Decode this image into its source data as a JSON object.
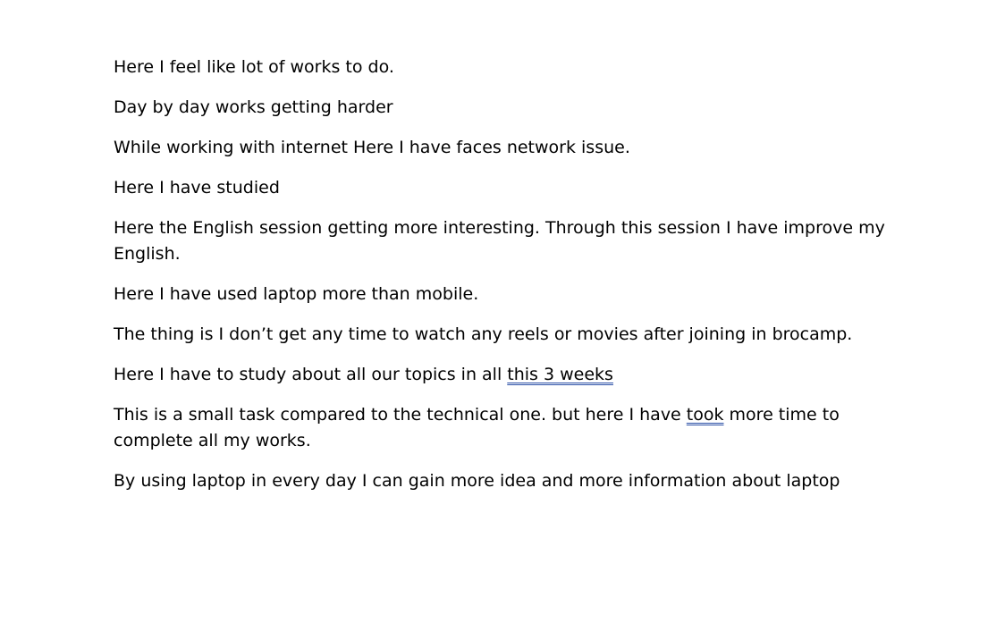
{
  "document": {
    "paragraphs": [
      {
        "id": "p1",
        "text": "Here I feel like lot of works to do."
      },
      {
        "id": "p2",
        "text": "Day by day works getting harder"
      },
      {
        "id": "p3",
        "text": "While working with internet Here I have faces network issue."
      },
      {
        "id": "p4",
        "text": "Here I have studied"
      },
      {
        "id": "p5",
        "text": "Here the English session getting more interesting. Through this session I have improve my English."
      },
      {
        "id": "p6",
        "text": "Here I have used laptop more than mobile."
      },
      {
        "id": "p7",
        "text": "The thing is I don’t get any time to watch any reels or movies after joining in brocamp."
      },
      {
        "id": "p8",
        "before": "Here I have to study about all our topics in all ",
        "flagged": "this 3 weeks",
        "after": ""
      },
      {
        "id": "p9",
        "before": "This is a small task compared to the technical one. but here I have ",
        "flagged": "took",
        "after": " more time to complete all my works."
      },
      {
        "id": "p10",
        "text": "By using laptop in every day I can gain more idea and more information about laptop"
      }
    ]
  },
  "colors": {
    "text": "#000000",
    "background": "#ffffff",
    "grammar_underline": "#2b4fa6"
  }
}
